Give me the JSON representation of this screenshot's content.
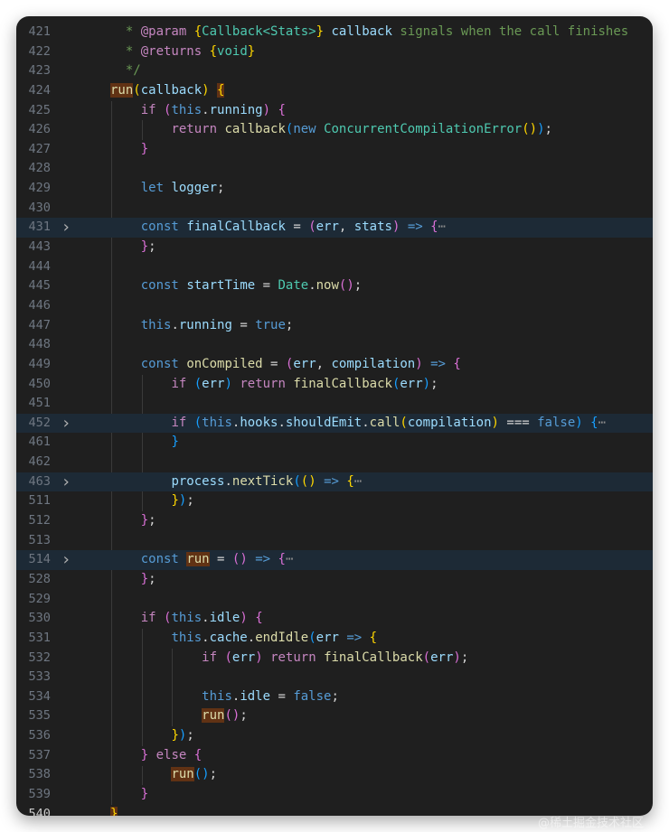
{
  "lines": [
    {
      "n": "421",
      "fold": false,
      "hl": false,
      "indent": 1,
      "tokens": [
        [
          "  * ",
          "c"
        ],
        [
          "@param",
          "ct"
        ],
        [
          " ",
          "c"
        ],
        [
          "{",
          "b1"
        ],
        [
          "Callback<Stats>",
          "ty"
        ],
        [
          "}",
          "b1"
        ],
        [
          " ",
          "c"
        ],
        [
          "callback",
          "v"
        ],
        [
          " signals when the call finishes",
          "c"
        ]
      ]
    },
    {
      "n": "422",
      "fold": false,
      "hl": false,
      "indent": 1,
      "tokens": [
        [
          "  * ",
          "c"
        ],
        [
          "@returns",
          "ct"
        ],
        [
          " ",
          "c"
        ],
        [
          "{",
          "b1"
        ],
        [
          "void",
          "ty"
        ],
        [
          "}",
          "b1"
        ]
      ]
    },
    {
      "n": "423",
      "fold": false,
      "hl": false,
      "indent": 1,
      "tokens": [
        [
          "  */",
          "c"
        ]
      ]
    },
    {
      "n": "424",
      "fold": false,
      "hl": false,
      "indent": 1,
      "tokens": [
        [
          "run",
          "fn hl"
        ],
        [
          "(",
          "b1"
        ],
        [
          "callback",
          "v"
        ],
        [
          ")",
          "b1"
        ],
        [
          " ",
          "p"
        ],
        [
          "{",
          "b1 hl"
        ]
      ]
    },
    {
      "n": "425",
      "fold": false,
      "hl": false,
      "indent": 2,
      "tokens": [
        [
          "if",
          "ct"
        ],
        [
          " ",
          "p"
        ],
        [
          "(",
          "b2"
        ],
        [
          "this",
          "kw"
        ],
        [
          ".",
          "p"
        ],
        [
          "running",
          "v"
        ],
        [
          ")",
          "b2"
        ],
        [
          " ",
          "p"
        ],
        [
          "{",
          "b2"
        ]
      ]
    },
    {
      "n": "426",
      "fold": false,
      "hl": false,
      "indent": 3,
      "tokens": [
        [
          "return",
          "ct"
        ],
        [
          " ",
          "p"
        ],
        [
          "callback",
          "fn"
        ],
        [
          "(",
          "b3"
        ],
        [
          "new",
          "kw"
        ],
        [
          " ",
          "p"
        ],
        [
          "ConcurrentCompilationError",
          "ty"
        ],
        [
          "()",
          "b1"
        ],
        [
          ")",
          "b3"
        ],
        [
          ";",
          "p"
        ]
      ]
    },
    {
      "n": "427",
      "fold": false,
      "hl": false,
      "indent": 2,
      "tokens": [
        [
          "}",
          "b2"
        ]
      ]
    },
    {
      "n": "428",
      "fold": false,
      "hl": false,
      "indent": 2,
      "tokens": []
    },
    {
      "n": "429",
      "fold": false,
      "hl": false,
      "indent": 2,
      "tokens": [
        [
          "let",
          "kw"
        ],
        [
          " ",
          "p"
        ],
        [
          "logger",
          "v"
        ],
        [
          ";",
          "p"
        ]
      ]
    },
    {
      "n": "430",
      "fold": false,
      "hl": false,
      "indent": 2,
      "tokens": []
    },
    {
      "n": "431",
      "fold": true,
      "hl": true,
      "indent": 2,
      "tokens": [
        [
          "const",
          "kw"
        ],
        [
          " ",
          "p"
        ],
        [
          "finalCallback",
          "v"
        ],
        [
          " = ",
          "p"
        ],
        [
          "(",
          "b2"
        ],
        [
          "err",
          "v"
        ],
        [
          ", ",
          "p"
        ],
        [
          "stats",
          "v"
        ],
        [
          ")",
          "b2"
        ],
        [
          " ",
          "p"
        ],
        [
          "=>",
          "kw"
        ],
        [
          " ",
          "p"
        ],
        [
          "{",
          "b2"
        ],
        [
          "⋯",
          "el"
        ]
      ]
    },
    {
      "n": "443",
      "fold": false,
      "hl": false,
      "indent": 2,
      "tokens": [
        [
          "}",
          "b2"
        ],
        [
          ";",
          "p"
        ]
      ]
    },
    {
      "n": "444",
      "fold": false,
      "hl": false,
      "indent": 2,
      "tokens": []
    },
    {
      "n": "445",
      "fold": false,
      "hl": false,
      "indent": 2,
      "tokens": [
        [
          "const",
          "kw"
        ],
        [
          " ",
          "p"
        ],
        [
          "startTime",
          "v"
        ],
        [
          " = ",
          "p"
        ],
        [
          "Date",
          "ty"
        ],
        [
          ".",
          "p"
        ],
        [
          "now",
          "fn"
        ],
        [
          "()",
          "b2"
        ],
        [
          ";",
          "p"
        ]
      ]
    },
    {
      "n": "446",
      "fold": false,
      "hl": false,
      "indent": 2,
      "tokens": []
    },
    {
      "n": "447",
      "fold": false,
      "hl": false,
      "indent": 2,
      "tokens": [
        [
          "this",
          "kw"
        ],
        [
          ".",
          "p"
        ],
        [
          "running",
          "v"
        ],
        [
          " = ",
          "p"
        ],
        [
          "true",
          "kw"
        ],
        [
          ";",
          "p"
        ]
      ]
    },
    {
      "n": "448",
      "fold": false,
      "hl": false,
      "indent": 2,
      "tokens": []
    },
    {
      "n": "449",
      "fold": false,
      "hl": false,
      "indent": 2,
      "tokens": [
        [
          "const",
          "kw"
        ],
        [
          " ",
          "p"
        ],
        [
          "onCompiled",
          "fn"
        ],
        [
          " = ",
          "p"
        ],
        [
          "(",
          "b2"
        ],
        [
          "err",
          "v"
        ],
        [
          ", ",
          "p"
        ],
        [
          "compilation",
          "v"
        ],
        [
          ")",
          "b2"
        ],
        [
          " ",
          "p"
        ],
        [
          "=>",
          "kw"
        ],
        [
          " ",
          "p"
        ],
        [
          "{",
          "b2"
        ]
      ]
    },
    {
      "n": "450",
      "fold": false,
      "hl": false,
      "indent": 3,
      "tokens": [
        [
          "if",
          "ct"
        ],
        [
          " ",
          "p"
        ],
        [
          "(",
          "b3"
        ],
        [
          "err",
          "v"
        ],
        [
          ")",
          "b3"
        ],
        [
          " ",
          "p"
        ],
        [
          "return",
          "ct"
        ],
        [
          " ",
          "p"
        ],
        [
          "finalCallback",
          "fn"
        ],
        [
          "(",
          "b3"
        ],
        [
          "err",
          "v"
        ],
        [
          ")",
          "b3"
        ],
        [
          ";",
          "p"
        ]
      ]
    },
    {
      "n": "451",
      "fold": false,
      "hl": false,
      "indent": 3,
      "tokens": []
    },
    {
      "n": "452",
      "fold": true,
      "hl": true,
      "indent": 3,
      "tokens": [
        [
          "if",
          "ct"
        ],
        [
          " ",
          "p"
        ],
        [
          "(",
          "b3"
        ],
        [
          "this",
          "kw"
        ],
        [
          ".",
          "p"
        ],
        [
          "hooks",
          "v"
        ],
        [
          ".",
          "p"
        ],
        [
          "shouldEmit",
          "v"
        ],
        [
          ".",
          "p"
        ],
        [
          "call",
          "fn"
        ],
        [
          "(",
          "b1"
        ],
        [
          "compilation",
          "v"
        ],
        [
          ")",
          "b1"
        ],
        [
          " === ",
          "p"
        ],
        [
          "false",
          "kw"
        ],
        [
          ")",
          "b3"
        ],
        [
          " ",
          "p"
        ],
        [
          "{",
          "b3"
        ],
        [
          "⋯",
          "el"
        ]
      ]
    },
    {
      "n": "461",
      "fold": false,
      "hl": false,
      "indent": 3,
      "tokens": [
        [
          "}",
          "b3"
        ]
      ]
    },
    {
      "n": "462",
      "fold": false,
      "hl": false,
      "indent": 3,
      "tokens": []
    },
    {
      "n": "463",
      "fold": true,
      "hl": true,
      "indent": 3,
      "tokens": [
        [
          "process",
          "v"
        ],
        [
          ".",
          "p"
        ],
        [
          "nextTick",
          "fn"
        ],
        [
          "(",
          "b3"
        ],
        [
          "()",
          "b1"
        ],
        [
          " ",
          "p"
        ],
        [
          "=>",
          "kw"
        ],
        [
          " ",
          "p"
        ],
        [
          "{",
          "b1"
        ],
        [
          "⋯",
          "el"
        ]
      ]
    },
    {
      "n": "511",
      "fold": false,
      "hl": false,
      "indent": 3,
      "tokens": [
        [
          "}",
          "b1"
        ],
        [
          ")",
          "b3"
        ],
        [
          ";",
          "p"
        ]
      ]
    },
    {
      "n": "512",
      "fold": false,
      "hl": false,
      "indent": 2,
      "tokens": [
        [
          "}",
          "b2"
        ],
        [
          ";",
          "p"
        ]
      ]
    },
    {
      "n": "513",
      "fold": false,
      "hl": false,
      "indent": 2,
      "tokens": []
    },
    {
      "n": "514",
      "fold": true,
      "hl": true,
      "indent": 2,
      "tokens": [
        [
          "const",
          "kw"
        ],
        [
          " ",
          "p"
        ],
        [
          "run",
          "fn hl"
        ],
        [
          " = ",
          "p"
        ],
        [
          "()",
          "b2"
        ],
        [
          " ",
          "p"
        ],
        [
          "=>",
          "kw"
        ],
        [
          " ",
          "p"
        ],
        [
          "{",
          "b2"
        ],
        [
          "⋯",
          "el"
        ]
      ]
    },
    {
      "n": "528",
      "fold": false,
      "hl": false,
      "indent": 2,
      "tokens": [
        [
          "}",
          "b2"
        ],
        [
          ";",
          "p"
        ]
      ]
    },
    {
      "n": "529",
      "fold": false,
      "hl": false,
      "indent": 2,
      "tokens": []
    },
    {
      "n": "530",
      "fold": false,
      "hl": false,
      "indent": 2,
      "tokens": [
        [
          "if",
          "ct"
        ],
        [
          " ",
          "p"
        ],
        [
          "(",
          "b2"
        ],
        [
          "this",
          "kw"
        ],
        [
          ".",
          "p"
        ],
        [
          "idle",
          "v"
        ],
        [
          ")",
          "b2"
        ],
        [
          " ",
          "p"
        ],
        [
          "{",
          "b2"
        ]
      ]
    },
    {
      "n": "531",
      "fold": false,
      "hl": false,
      "indent": 3,
      "tokens": [
        [
          "this",
          "kw"
        ],
        [
          ".",
          "p"
        ],
        [
          "cache",
          "v"
        ],
        [
          ".",
          "p"
        ],
        [
          "endIdle",
          "fn"
        ],
        [
          "(",
          "b3"
        ],
        [
          "err",
          "v"
        ],
        [
          " ",
          "p"
        ],
        [
          "=>",
          "kw"
        ],
        [
          " ",
          "p"
        ],
        [
          "{",
          "b1"
        ]
      ]
    },
    {
      "n": "532",
      "fold": false,
      "hl": false,
      "indent": 4,
      "tokens": [
        [
          "if",
          "ct"
        ],
        [
          " ",
          "p"
        ],
        [
          "(",
          "b2"
        ],
        [
          "err",
          "v"
        ],
        [
          ")",
          "b2"
        ],
        [
          " ",
          "p"
        ],
        [
          "return",
          "ct"
        ],
        [
          " ",
          "p"
        ],
        [
          "finalCallback",
          "fn"
        ],
        [
          "(",
          "b2"
        ],
        [
          "err",
          "v"
        ],
        [
          ")",
          "b2"
        ],
        [
          ";",
          "p"
        ]
      ]
    },
    {
      "n": "533",
      "fold": false,
      "hl": false,
      "indent": 4,
      "tokens": []
    },
    {
      "n": "534",
      "fold": false,
      "hl": false,
      "indent": 4,
      "tokens": [
        [
          "this",
          "kw"
        ],
        [
          ".",
          "p"
        ],
        [
          "idle",
          "v"
        ],
        [
          " = ",
          "p"
        ],
        [
          "false",
          "kw"
        ],
        [
          ";",
          "p"
        ]
      ]
    },
    {
      "n": "535",
      "fold": false,
      "hl": false,
      "indent": 4,
      "tokens": [
        [
          "run",
          "fn hl"
        ],
        [
          "()",
          "b2"
        ],
        [
          ";",
          "p"
        ]
      ]
    },
    {
      "n": "536",
      "fold": false,
      "hl": false,
      "indent": 3,
      "tokens": [
        [
          "}",
          "b1"
        ],
        [
          ")",
          "b3"
        ],
        [
          ";",
          "p"
        ]
      ]
    },
    {
      "n": "537",
      "fold": false,
      "hl": false,
      "indent": 2,
      "tokens": [
        [
          "}",
          "b2"
        ],
        [
          " ",
          "p"
        ],
        [
          "else",
          "ct"
        ],
        [
          " ",
          "p"
        ],
        [
          "{",
          "b2"
        ]
      ]
    },
    {
      "n": "538",
      "fold": false,
      "hl": false,
      "indent": 3,
      "tokens": [
        [
          "run",
          "fn hl"
        ],
        [
          "()",
          "b3"
        ],
        [
          ";",
          "p"
        ]
      ]
    },
    {
      "n": "539",
      "fold": false,
      "hl": false,
      "indent": 2,
      "tokens": [
        [
          "}",
          "b2"
        ]
      ]
    },
    {
      "n": "540",
      "fold": false,
      "hl": false,
      "indent": 1,
      "current": true,
      "tokens": [
        [
          "}",
          "b1 hl"
        ]
      ]
    }
  ],
  "watermark": "@稀土掘金技术社区"
}
